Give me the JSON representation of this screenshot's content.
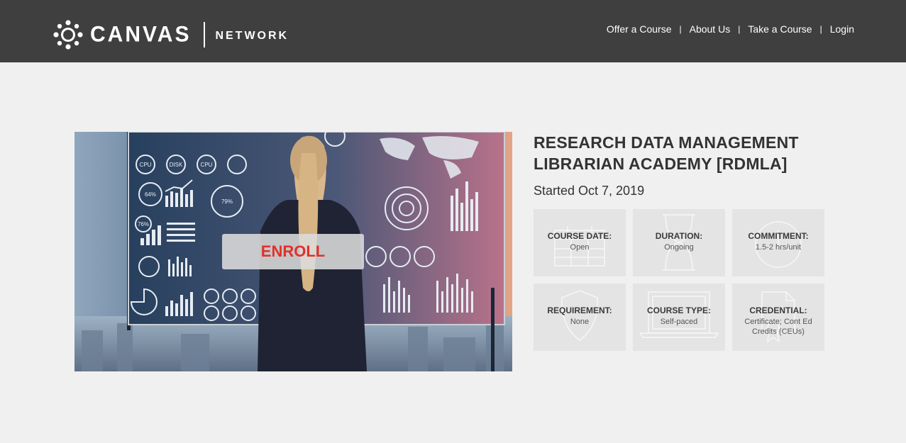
{
  "header": {
    "logo_primary": "CANVAS",
    "logo_secondary": "NETWORK",
    "nav": [
      {
        "label": "Offer a Course"
      },
      {
        "label": "About Us"
      },
      {
        "label": "Take a Course"
      },
      {
        "label": "Login"
      }
    ],
    "separator": "|"
  },
  "hero": {
    "enroll_label": "ENROLL",
    "gauge_texts": [
      "CPU",
      "DISK",
      "CPU",
      "64%",
      "79%",
      "76%"
    ]
  },
  "course": {
    "title_line1": "RESEARCH DATA MANAGEMENT",
    "title_line2": "LIBRARIAN ACADEMY [RDMLA]",
    "started": "Started Oct 7, 2019"
  },
  "tiles": [
    {
      "label": "COURSE DATE:",
      "value": "Open",
      "icon": "calendar-icon"
    },
    {
      "label": "DURATION:",
      "value": "Ongoing",
      "icon": "hourglass-icon"
    },
    {
      "label": "COMMITMENT:",
      "value": "1.5-2 hrs/unit",
      "icon": "clock-icon"
    },
    {
      "label": "REQUIREMENT:",
      "value": "None",
      "icon": "shield-icon"
    },
    {
      "label": "COURSE TYPE:",
      "value": "Self-paced",
      "icon": "laptop-icon"
    },
    {
      "label": "CREDENTIAL:",
      "value": "Certificate; Cont Ed Credits (CEUs)",
      "icon": "certificate-icon"
    }
  ],
  "colors": {
    "topbar": "#3f3f3f",
    "background": "#f0f0f0",
    "tile": "#e4e4e4",
    "enroll_text": "#e0312a"
  }
}
